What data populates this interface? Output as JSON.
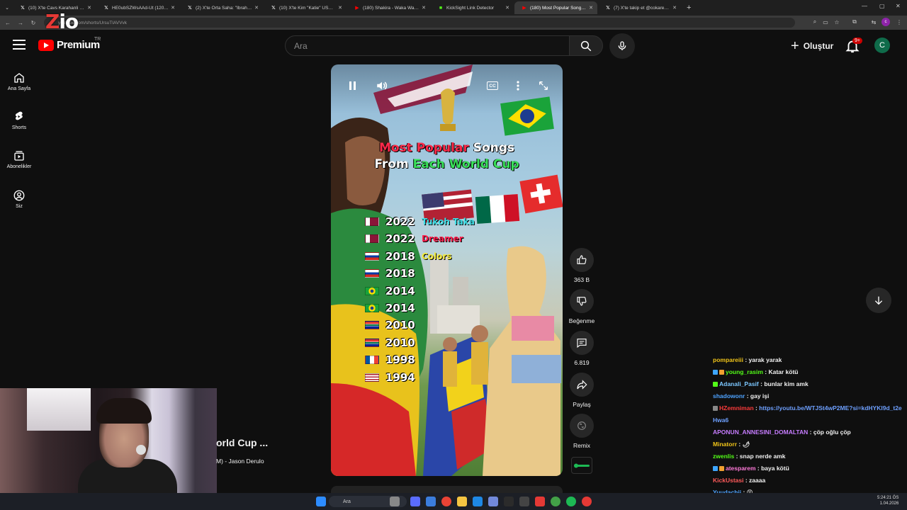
{
  "browser": {
    "tabs": [
      {
        "title": "(10) X'te Cavs Karahanli :m \"bu..",
        "icon": "x-icon",
        "color": "#ffffff",
        "active": false
      },
      {
        "title": "HE0ubSZWsAAd-Ut (1206×564)",
        "icon": "x-icon",
        "color": "#ffffff",
        "active": false
      },
      {
        "title": "(2) X'te Orta Saha: \"Ibrahim Ha..",
        "icon": "x-icon",
        "color": "#ffffff",
        "active": false
      },
      {
        "title": "(10) X'te Kim \"Katie\" USA: 🔴",
        "icon": "x-icon",
        "color": "#ffffff",
        "active": false
      },
      {
        "title": "(180) Shakira - Waka Waka (Thi..",
        "icon": "youtube-icon",
        "color": "#ff0000",
        "active": false
      },
      {
        "title": "KickSight Link Detector",
        "icon": "kick-icon",
        "color": "#53fc18",
        "active": false
      },
      {
        "title": "(180) Most Popular Songs Fr..",
        "icon": "youtube-icon",
        "color": "#ff0000",
        "active": true
      },
      {
        "title": "(7) X'te takip et @cokaregs: \"Ib..",
        "icon": "x-icon",
        "color": "#ffffff",
        "active": false
      }
    ],
    "url": "youtube.com/shorts/UrsuTIAVVvk",
    "new_tab": "+",
    "profile_letter": "c"
  },
  "stream_logo": {
    "z": "Z",
    "rest": "io"
  },
  "header": {
    "logo_text": "Premium",
    "country": "TR",
    "search_placeholder": "Ara",
    "create_label": "Oluştur",
    "notification_count": "9+",
    "avatar_letter": "C"
  },
  "sidebar": {
    "items": [
      {
        "label": "Ana Sayfa",
        "icon": "home-icon"
      },
      {
        "label": "Shorts",
        "icon": "shorts-icon"
      },
      {
        "label": "Abonelikler",
        "icon": "subscriptions-icon"
      },
      {
        "label": "Siz",
        "icon": "account-icon"
      }
    ]
  },
  "video": {
    "title_line1_highlight": "Most Popular",
    "title_line1_rest": "Songs",
    "title_line2_prefix": "From",
    "title_line2_highlight": "Each World Cup",
    "entries": [
      {
        "year": "2022",
        "song": "Tukoh Taka",
        "song_color": "#3fe0e8",
        "flag": "qatar"
      },
      {
        "year": "2022",
        "song": "Dreamer",
        "song_color": "#ff1e4c",
        "flag": "qatar"
      },
      {
        "year": "2018",
        "song": "Colors",
        "song_color": "#f2ea3a",
        "flag": "russia"
      },
      {
        "year": "2018",
        "song": "",
        "song_color": "#ffffff",
        "flag": "russia"
      },
      {
        "year": "2014",
        "song": "",
        "song_color": "#ffffff",
        "flag": "brazil"
      },
      {
        "year": "2014",
        "song": "",
        "song_color": "#ffffff",
        "flag": "brazil"
      },
      {
        "year": "2010",
        "song": "",
        "song_color": "#ffffff",
        "flag": "south-africa"
      },
      {
        "year": "2010",
        "song": "",
        "song_color": "#ffffff",
        "flag": "south-africa"
      },
      {
        "year": "1998",
        "song": "",
        "song_color": "#ffffff",
        "flag": "france"
      },
      {
        "year": "1994",
        "song": "",
        "song_color": "#ffffff",
        "flag": "usa"
      }
    ]
  },
  "actions": {
    "likes": "363 B",
    "dislike_label": "Beğenme",
    "comments": "6.819",
    "share_label": "Paylaş",
    "remix_label": "Remix"
  },
  "now_playing": {
    "title": "orld Cup ...",
    "artist": "M) - Jason Derulo"
  },
  "chat": [
    {
      "user": "pompareiii",
      "color": "#f0c419",
      "text": "yarak yarak",
      "badges": []
    },
    {
      "user": "young_rasim",
      "color": "#53fc18",
      "text": "Katar kötü",
      "badges": [
        "#3ea6ff",
        "#f0a030"
      ]
    },
    {
      "user": "Adanali_Pasif",
      "color": "#7cc7ff",
      "text": "bunlar kim amk",
      "badges": [
        "#53fc18"
      ]
    },
    {
      "user": "shadowonr",
      "color": "#4ea3ff",
      "text": "gay işi",
      "badges": []
    },
    {
      "user": "HZemniman",
      "color": "#ff3b3b",
      "text": "",
      "link": "https://youtu.be/WTJSt4wP2ME?si=kdHYKl9d_t2eHwa6",
      "badges": [
        "#888888"
      ]
    },
    {
      "user": "APONUN_ANNESINI_DOMALTAN",
      "color": "#c77dff",
      "text": "çöp oğlu çöp",
      "badges": []
    },
    {
      "user": "Minatorr",
      "color": "#f0c419",
      "text": "🌶",
      "badges": []
    },
    {
      "user": "zwenlis",
      "color": "#53fc18",
      "text": "snap nerde amk",
      "badges": []
    },
    {
      "user": "atesparem",
      "color": "#ff7ad9",
      "text": "baya kötü",
      "badges": [
        "#3ea6ff",
        "#f0a030"
      ]
    },
    {
      "user": "KickUstasi",
      "color": "#ff5a5a",
      "text": "zaaaa",
      "badges": []
    },
    {
      "user": "Yuudachii",
      "color": "#4ea3ff",
      "text": "😡",
      "badges": []
    }
  ],
  "taskbar": {
    "search_placeholder": "Ara",
    "time": "5:24:21 ÖS",
    "date": "1.04.2026"
  }
}
